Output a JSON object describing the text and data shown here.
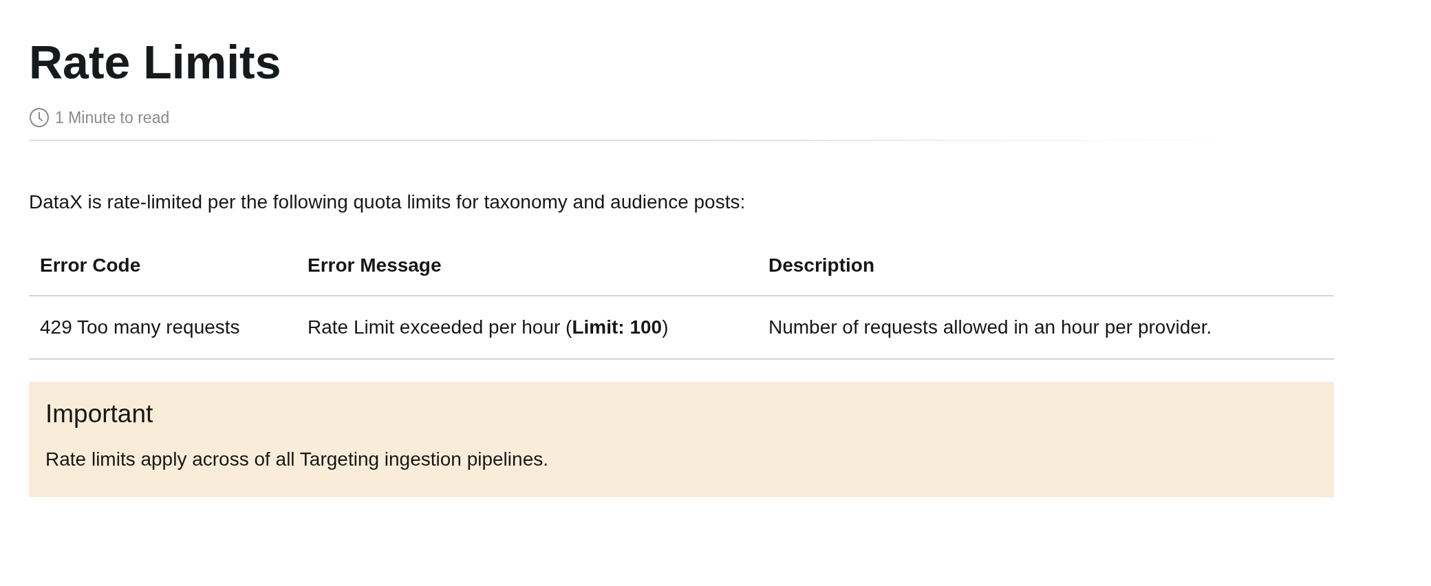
{
  "title": "Rate Limits",
  "read_time": "1 Minute to read",
  "intro": "DataX is rate-limited per the following quota limits for taxonomy and audience posts:",
  "table": {
    "columns": [
      "Error Code",
      "Error Message",
      "Description"
    ],
    "rows": [
      [
        "429 Too many requests",
        "Rate Limit exceeded per hour (**Limit: 100**)",
        "Number of requests allowed in an hour per provider."
      ]
    ]
  },
  "callout": {
    "title": "Important",
    "text": "Rate limits apply across of all Targeting ingestion pipelines."
  }
}
